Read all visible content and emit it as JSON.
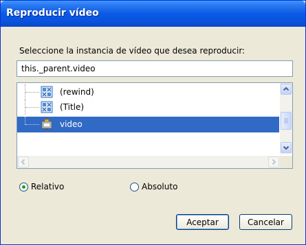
{
  "window": {
    "title": "Reproducir vídeo"
  },
  "prompt": "Seleccione la instancia de vídeo que desea reproducir:",
  "path_value": "this._parent.video",
  "tree": {
    "items": [
      {
        "label": "(rewind)",
        "icon": "movieclip-icon",
        "selected": false
      },
      {
        "label": "(Title)",
        "icon": "movieclip-icon",
        "selected": false
      },
      {
        "label": "video",
        "icon": "video-instance-icon",
        "selected": true
      }
    ]
  },
  "radios": {
    "relative_label": "Relativo",
    "absolute_label": "Absoluto",
    "selected": "relative"
  },
  "buttons": {
    "ok": "Aceptar",
    "cancel": "Cancelar"
  },
  "colors": {
    "selection": "#316ac5",
    "titlebar": "#0a5ae6"
  }
}
